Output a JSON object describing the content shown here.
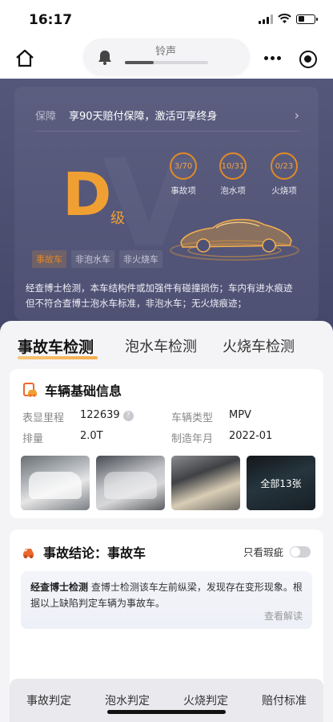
{
  "status_bar": {
    "time": "16:17"
  },
  "top_nav": {
    "ringtone_label": "铃声",
    "ringtone_level": 0.35
  },
  "hero": {
    "guarantee_tag": "保障",
    "guarantee_text": "享90天赔付保障，激活可享终身",
    "grade_letter": "D",
    "grade_suffix": "级",
    "stats": [
      {
        "value": "3/70",
        "label": "事故项"
      },
      {
        "value": "10/31",
        "label": "泡水项"
      },
      {
        "value": "0/23",
        "label": "火烧项"
      }
    ],
    "tags": [
      {
        "label": "事故车",
        "active": true
      },
      {
        "label": "非泡水车",
        "active": false
      },
      {
        "label": "非火烧车",
        "active": false
      }
    ],
    "description": "经查博士检测，本车结构件或加强件有碰撞损伤；车内有进水痕迹但不符合查博士泡水车标准，非泡水车；无火烧痕迹；"
  },
  "tabs": [
    "事故车检测",
    "泡水车检测",
    "火烧车检测"
  ],
  "base_info": {
    "title": "车辆基础信息",
    "mileage_label": "表显里程",
    "mileage_value": "122639",
    "type_label": "车辆类型",
    "type_value": "MPV",
    "displacement_label": "排量",
    "displacement_value": "2.0T",
    "date_label": "制造年月",
    "date_value": "2022-01",
    "photos_overlay": "全部13张"
  },
  "accident": {
    "title": "事故结论：事故车",
    "only_flaws_label": "只看瑕疵",
    "doctor_name": "经查博士检测",
    "doctor_text": " 查博士检测该车左前纵梁，发现存在变形现象。根据以上缺陷判定车辆为事故车。",
    "view_more": "查看解读"
  },
  "bottom_nav": [
    "事故判定",
    "泡水判定",
    "火烧判定",
    "赔付标准"
  ],
  "colors": {
    "accent": "#f0a032",
    "hero_bg": "#4f5174"
  }
}
